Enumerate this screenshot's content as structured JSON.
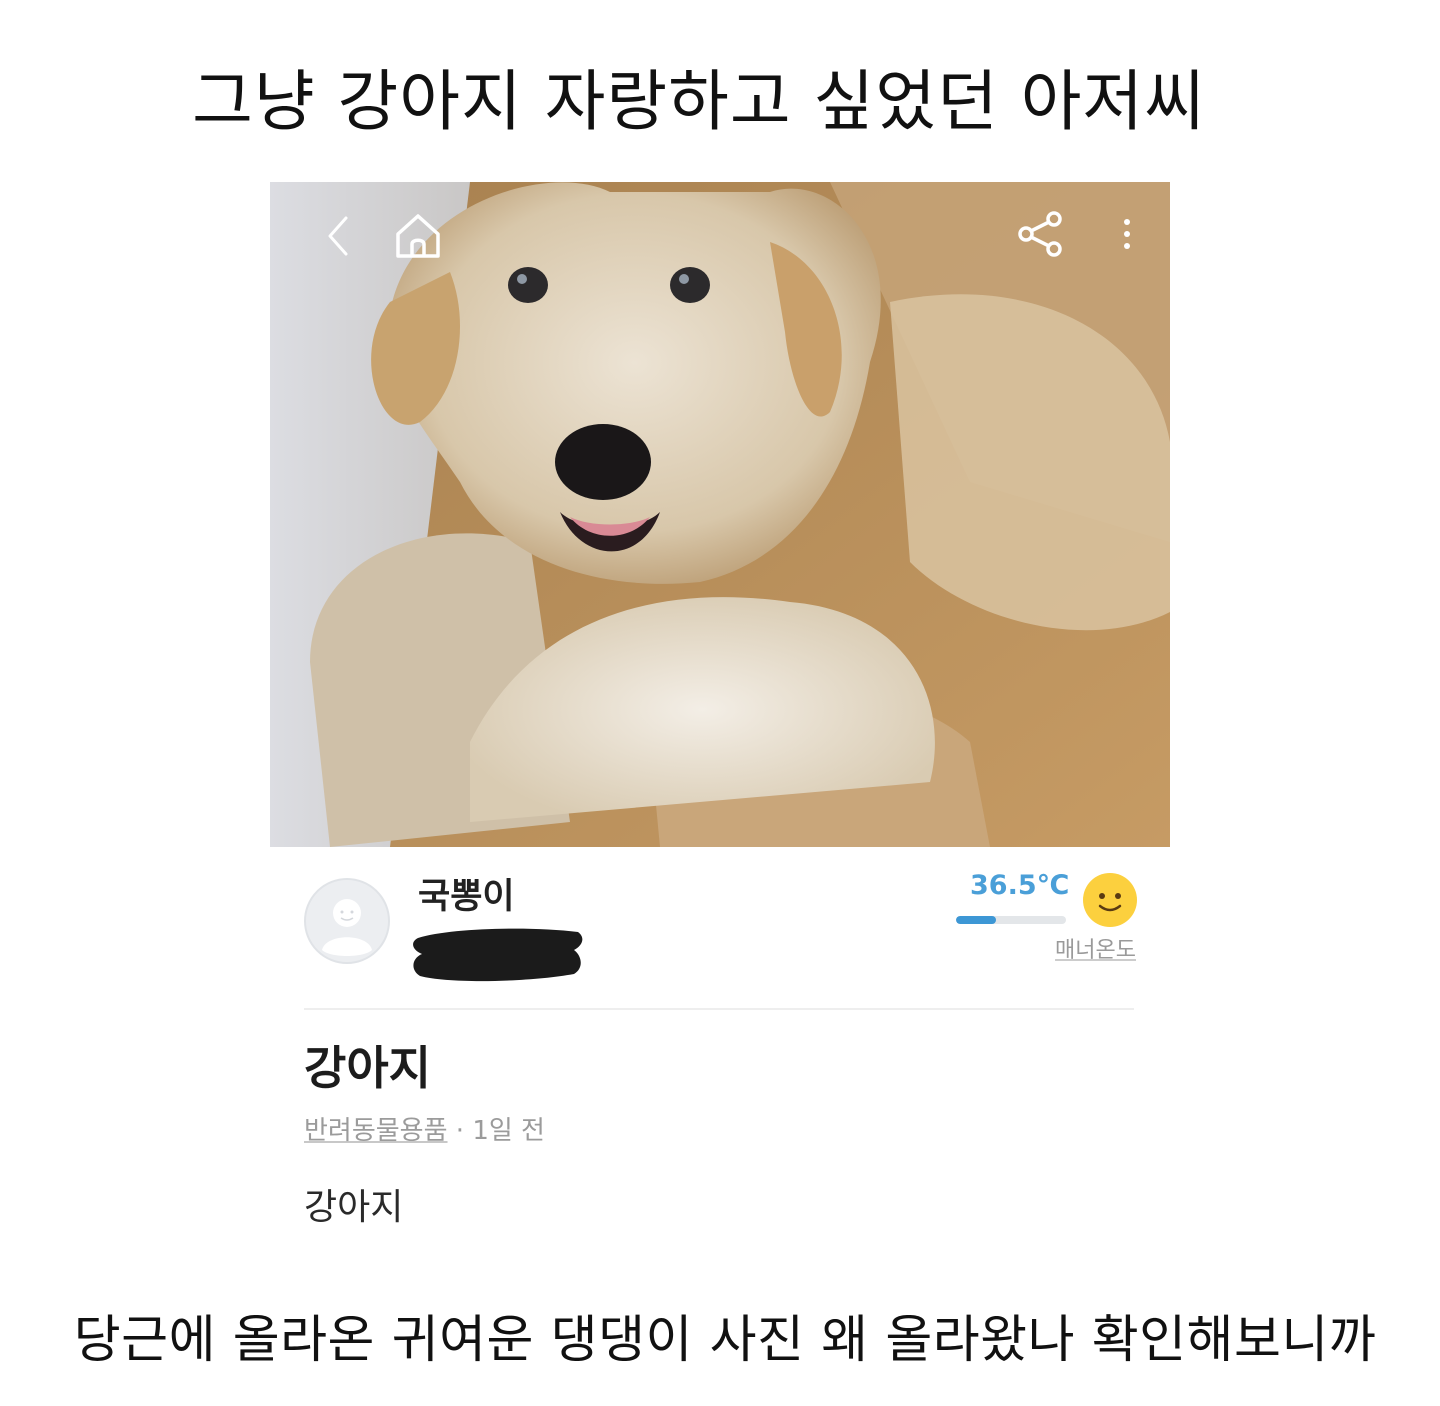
{
  "headline": "그냥 강아지 자랑하고 싶었던 아저씨",
  "caption": "당근에 올라온 귀여운 댕댕이 사진 왜 올라왔나 확인해보니까",
  "app": {
    "topbar": {
      "back_icon": "chevron-left-icon",
      "home_icon": "home-icon",
      "share_icon": "share-icon",
      "more_icon": "more-vertical-icon"
    },
    "profile": {
      "nickname": "국뽕이",
      "manner_temp": "36.5℃",
      "manner_temp_level": 0.365,
      "manner_label": "매너온도",
      "temp_color": "#3d97d5",
      "face_icon": "smiley-face-icon"
    },
    "post": {
      "title": "강아지",
      "category": "반려동물용품",
      "time": " · 1일 전",
      "body": "강아지"
    }
  }
}
